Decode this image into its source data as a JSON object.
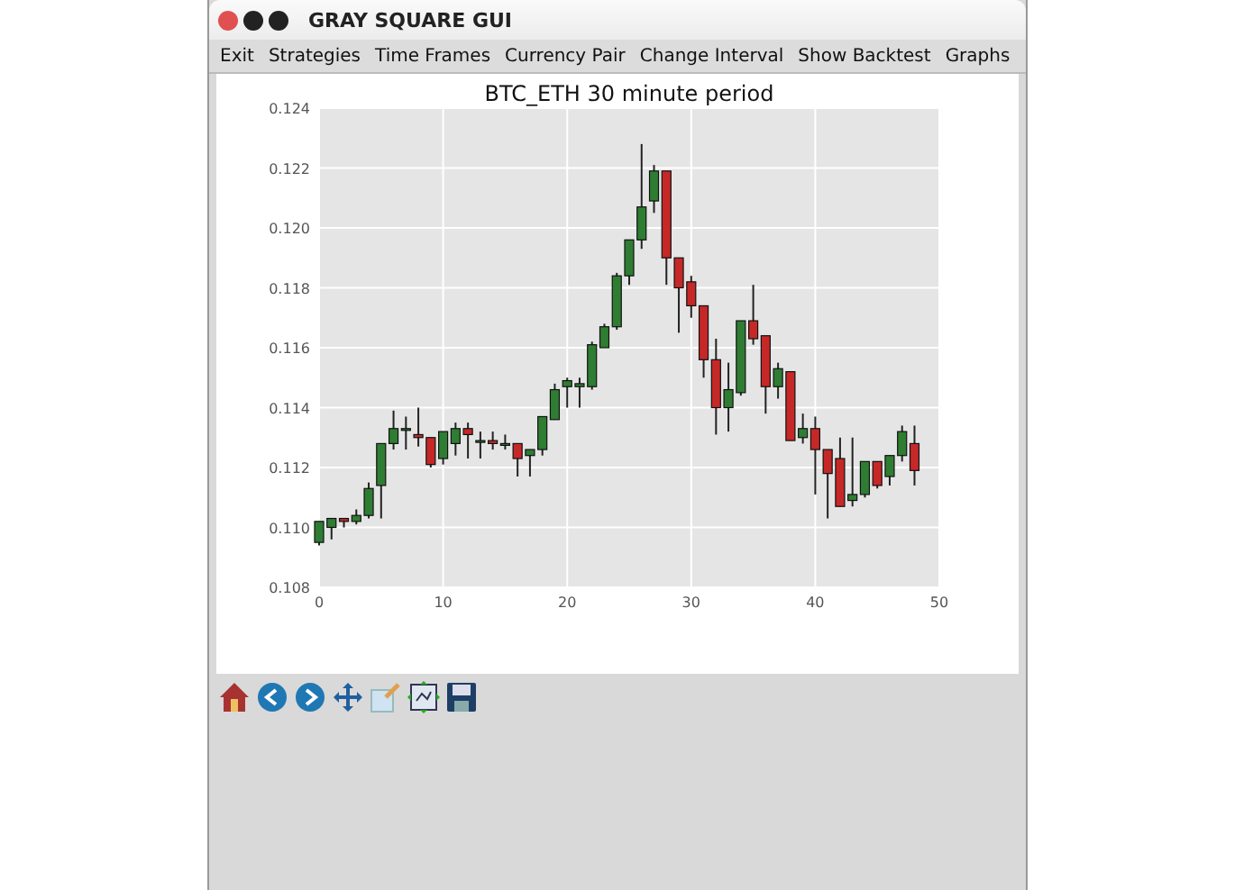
{
  "window": {
    "title": "GRAY SQUARE GUI"
  },
  "menu": [
    "Exit",
    "Strategies",
    "Time Frames",
    "Currency Pair",
    "Change Interval",
    "Show Backtest",
    "Graphs"
  ],
  "chart": {
    "chart_data": {
      "type": "candlestick",
      "grid": true,
      "title": "BTC_ETH 30 minute period",
      "x": [
        0,
        1,
        2,
        3,
        4,
        5,
        6,
        7,
        8,
        9,
        10,
        11,
        12,
        13,
        14,
        15,
        16,
        17,
        18,
        19,
        20,
        21,
        22,
        23,
        24,
        25,
        26,
        27,
        28,
        29,
        30,
        31,
        32,
        33,
        34,
        35,
        36,
        37,
        38,
        39,
        40,
        41,
        42,
        43,
        44,
        45,
        46,
        47,
        48
      ],
      "ohlc": [
        [
          0.1095,
          0.1102,
          0.1094,
          0.1102
        ],
        [
          0.11,
          0.1103,
          0.1096,
          0.1103
        ],
        [
          0.1103,
          0.1103,
          0.11,
          0.1102
        ],
        [
          0.1102,
          0.1106,
          0.1101,
          0.1104
        ],
        [
          0.1104,
          0.1115,
          0.1103,
          0.1113
        ],
        [
          0.1114,
          0.1128,
          0.1103,
          0.1128
        ],
        [
          0.1128,
          0.1139,
          0.1126,
          0.1133
        ],
        [
          0.1133,
          0.1137,
          0.1126,
          0.1133
        ],
        [
          0.1131,
          0.114,
          0.1127,
          0.113
        ],
        [
          0.113,
          0.113,
          0.112,
          0.1121
        ],
        [
          0.1123,
          0.1132,
          0.1121,
          0.1132
        ],
        [
          0.1128,
          0.1135,
          0.1124,
          0.1133
        ],
        [
          0.1133,
          0.1135,
          0.1123,
          0.1131
        ],
        [
          0.1129,
          0.1132,
          0.1123,
          0.1129
        ],
        [
          0.1129,
          0.1132,
          0.1126,
          0.1128
        ],
        [
          0.1128,
          0.1131,
          0.1126,
          0.1128
        ],
        [
          0.1128,
          0.1128,
          0.1117,
          0.1123
        ],
        [
          0.1124,
          0.1126,
          0.1117,
          0.1126
        ],
        [
          0.1126,
          0.1137,
          0.1124,
          0.1137
        ],
        [
          0.1136,
          0.1148,
          0.1136,
          0.1146
        ],
        [
          0.1147,
          0.115,
          0.114,
          0.1149
        ],
        [
          0.1147,
          0.115,
          0.114,
          0.1148
        ],
        [
          0.1147,
          0.1162,
          0.1146,
          0.1161
        ],
        [
          0.116,
          0.1168,
          0.116,
          0.1167
        ],
        [
          0.1167,
          0.1185,
          0.1166,
          0.1184
        ],
        [
          0.1184,
          0.1196,
          0.1181,
          0.1196
        ],
        [
          0.1196,
          0.1228,
          0.1193,
          0.1207
        ],
        [
          0.1209,
          0.1221,
          0.1205,
          0.1219
        ],
        [
          0.1219,
          0.1219,
          0.1181,
          0.119
        ],
        [
          0.119,
          0.119,
          0.1165,
          0.118
        ],
        [
          0.1182,
          0.1184,
          0.117,
          0.1174
        ],
        [
          0.1174,
          0.1174,
          0.115,
          0.1156
        ],
        [
          0.1156,
          0.1163,
          0.1131,
          0.114
        ],
        [
          0.114,
          0.1155,
          0.1132,
          0.1146
        ],
        [
          0.1145,
          0.1169,
          0.1144,
          0.1169
        ],
        [
          0.1169,
          0.1181,
          0.1161,
          0.1163
        ],
        [
          0.1164,
          0.1164,
          0.1138,
          0.1147
        ],
        [
          0.1147,
          0.1155,
          0.1143,
          0.1153
        ],
        [
          0.1152,
          0.1152,
          0.1129,
          0.1129
        ],
        [
          0.113,
          0.1138,
          0.1128,
          0.1133
        ],
        [
          0.1133,
          0.1137,
          0.1111,
          0.1126
        ],
        [
          0.1126,
          0.1126,
          0.1103,
          0.1118
        ],
        [
          0.1123,
          0.113,
          0.1107,
          0.1107
        ],
        [
          0.1109,
          0.113,
          0.1107,
          0.1111
        ],
        [
          0.1111,
          0.1122,
          0.111,
          0.1122
        ],
        [
          0.1122,
          0.1122,
          0.1113,
          0.1114
        ],
        [
          0.1117,
          0.1124,
          0.1114,
          0.1124
        ],
        [
          0.1124,
          0.1134,
          0.1122,
          0.1132
        ],
        [
          0.1128,
          0.1134,
          0.1114,
          0.1119
        ]
      ],
      "xlim": [
        0,
        50
      ],
      "ylim": [
        0.108,
        0.124
      ],
      "xticks": [
        0,
        10,
        20,
        30,
        40,
        50
      ],
      "yticks": [
        {
          "value": 0.108,
          "label": "0.108"
        },
        {
          "value": 0.11,
          "label": "0.110"
        },
        {
          "value": 0.112,
          "label": "0.112"
        },
        {
          "value": 0.114,
          "label": "0.114"
        },
        {
          "value": 0.116,
          "label": "0.116"
        },
        {
          "value": 0.118,
          "label": "0.118"
        },
        {
          "value": 0.12,
          "label": "0.120"
        },
        {
          "value": 0.122,
          "label": "0.122"
        },
        {
          "value": 0.124,
          "label": "0.124"
        }
      ]
    }
  },
  "toolbar": [
    {
      "kind": "home"
    },
    {
      "kind": "back"
    },
    {
      "kind": "forward"
    },
    {
      "kind": "pan"
    },
    {
      "kind": "zoom"
    },
    {
      "kind": "subplots"
    },
    {
      "kind": "save"
    }
  ]
}
